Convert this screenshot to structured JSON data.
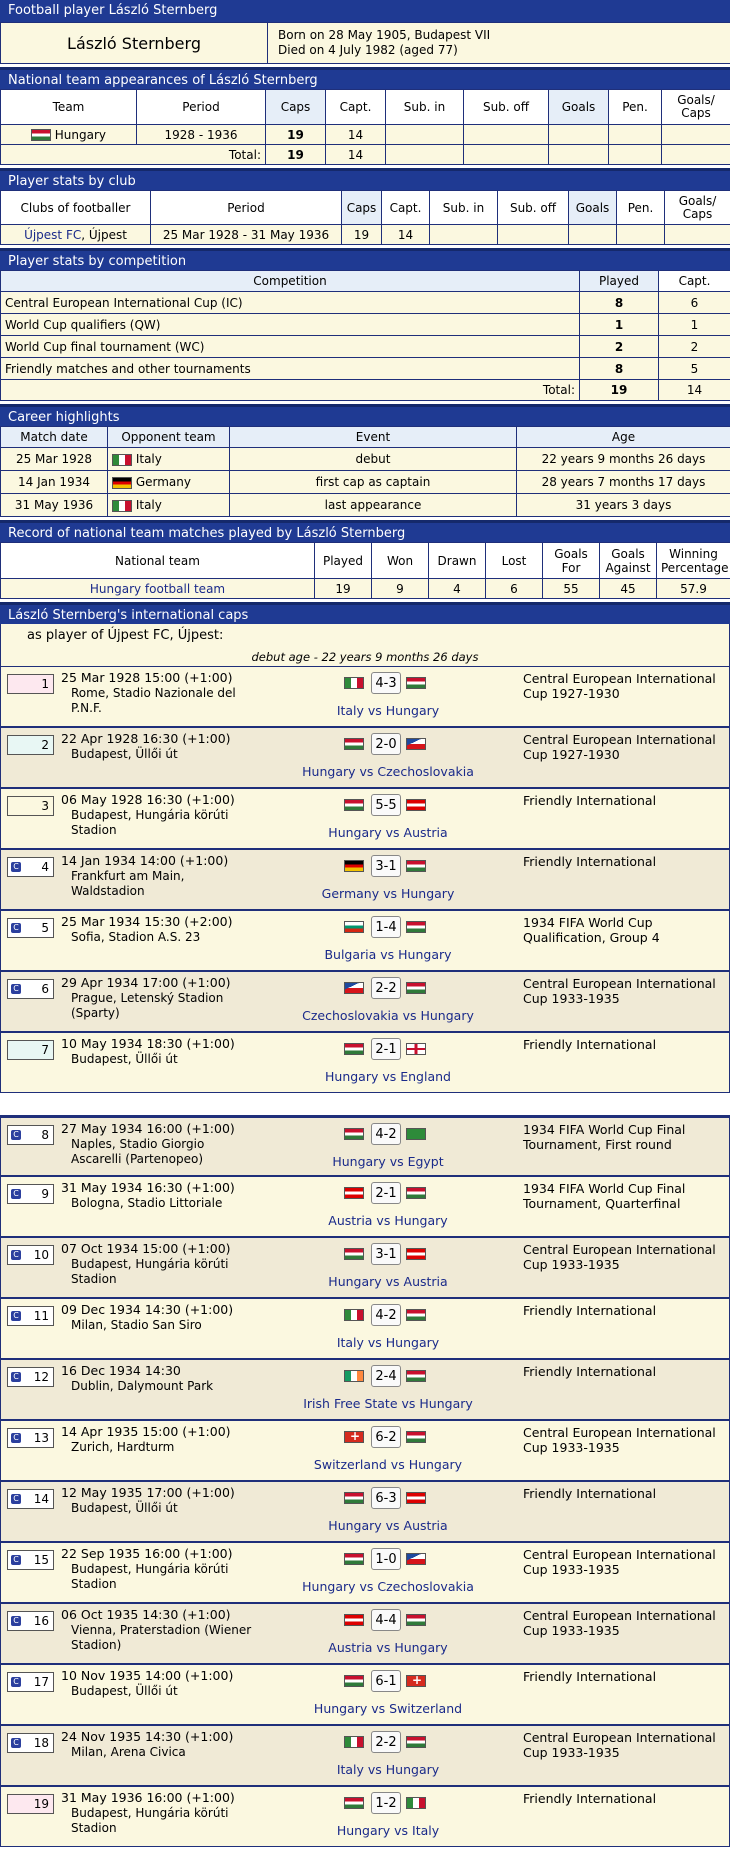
{
  "header": {
    "title": "Football player László Sternberg",
    "name": "László Sternberg",
    "born": "Born on 28 May 1905, Budapest VII",
    "died": "Died on 4 July 1982 (aged 77)"
  },
  "appearances": {
    "title": "National team appearances of László Sternberg",
    "cols": [
      "Team",
      "Period",
      "Caps",
      "Capt.",
      "Sub. in",
      "Sub. off",
      "Goals",
      "Pen.",
      "Goals/ Caps"
    ],
    "row": {
      "team": "Hungary",
      "period": "1928 - 1936",
      "caps": "19",
      "capt": "14"
    },
    "total": {
      "label": "Total:",
      "caps": "19",
      "capt": "14"
    }
  },
  "club": {
    "title": "Player stats by club",
    "cols": [
      "Clubs of footballer",
      "Period",
      "Caps",
      "Capt.",
      "Sub. in",
      "Sub. off",
      "Goals",
      "Pen.",
      "Goals/ Caps"
    ],
    "row": {
      "club": "Újpest FC",
      "city": ", Újpest",
      "period": "25 Mar 1928 - 31 May 1936",
      "caps": "19",
      "capt": "14"
    }
  },
  "competition": {
    "title": "Player stats by competition",
    "cols": [
      "Competition",
      "Played",
      "Capt."
    ],
    "rows": [
      {
        "name": "Central European International Cup (IC)",
        "played": "8",
        "capt": "6"
      },
      {
        "name": "World Cup qualifiers (QW)",
        "played": "1",
        "capt": "1"
      },
      {
        "name": "World Cup final tournament (WC)",
        "played": "2",
        "capt": "2"
      },
      {
        "name": "Friendly matches and other tournaments",
        "played": "8",
        "capt": "5"
      }
    ],
    "total": {
      "label": "Total:",
      "played": "19",
      "capt": "14"
    }
  },
  "highlights": {
    "title": "Career highlights",
    "cols": [
      "Match date",
      "Opponent team",
      "Event",
      "Age"
    ],
    "rows": [
      {
        "date": "25 Mar 1928",
        "flag": "fl-ita",
        "opp": "Italy",
        "event": "debut",
        "age": "22 years 9 months 26 days"
      },
      {
        "date": "14 Jan 1934",
        "flag": "fl-ger",
        "opp": "Germany",
        "event": "first cap as captain",
        "age": "28 years 7 months 17 days"
      },
      {
        "date": "31 May 1936",
        "flag": "fl-ita",
        "opp": "Italy",
        "event": "last appearance",
        "age": "31 years 3 days"
      }
    ]
  },
  "record": {
    "title": "Record of national team matches played by László Sternberg",
    "cols": [
      "National team",
      "Played",
      "Won",
      "Drawn",
      "Lost",
      "Goals For",
      "Goals Against",
      "Winning Percentage"
    ],
    "row": {
      "team": "Hungary football team",
      "played": "19",
      "won": "9",
      "drawn": "4",
      "lost": "6",
      "gf": "55",
      "ga": "45",
      "pct": "57.9"
    }
  },
  "caps": {
    "title": "László Sternberg's international caps",
    "as_player": "as player of Újpest FC, Újpest:",
    "debut_note": "debut age - 22 years 9 months 26 days",
    "matches": [
      {
        "n": "1",
        "date": "25 Mar 1928 15:00 (+1:00)",
        "venue": "Rome, Stadio Nazionale del P.N.F.",
        "f1": "fl-ita",
        "score": "4-3",
        "f2": "fl-hun",
        "teams": "Italy vs Hungary",
        "comp": "Central European International Cup 1927-1930"
      },
      {
        "n": "2",
        "date": "22 Apr 1928 16:30 (+1:00)",
        "venue": "Budapest, Üllői út",
        "f1": "fl-hun",
        "score": "2-0",
        "f2": "fl-cze",
        "teams": "Hungary vs Czechoslovakia",
        "comp": "Central European International Cup 1927-1930"
      },
      {
        "n": "3",
        "date": "06 May 1928 16:30 (+1:00)",
        "venue": "Budapest, Hungária körúti Stadion",
        "f1": "fl-hun",
        "score": "5-5",
        "f2": "fl-aut",
        "teams": "Hungary vs Austria",
        "comp": "Friendly International"
      },
      {
        "n": "4",
        "date": "14 Jan 1934 14:00 (+1:00)",
        "venue": "Frankfurt am Main, Waldstadion",
        "f1": "fl-ger",
        "score": "3-1",
        "f2": "fl-hun",
        "teams": "Germany vs Hungary",
        "comp": "Friendly International"
      },
      {
        "n": "5",
        "date": "25 Mar 1934 15:30 (+2:00)",
        "venue": "Sofia, Stadion A.S. 23",
        "f1": "fl-bul",
        "score": "1-4",
        "f2": "fl-hun",
        "teams": "Bulgaria vs Hungary",
        "comp": "1934 FIFA World Cup Qualification, Group 4"
      },
      {
        "n": "6",
        "date": "29 Apr 1934 17:00 (+1:00)",
        "venue": "Prague, Letenský Stadion (Sparty)",
        "f1": "fl-cze",
        "score": "2-2",
        "f2": "fl-hun",
        "teams": "Czechoslovakia vs Hungary",
        "comp": "Central European International Cup 1933-1935"
      },
      {
        "n": "7",
        "date": "10 May 1934 18:30 (+1:00)",
        "venue": "Budapest, Üllői út",
        "f1": "fl-hun",
        "score": "2-1",
        "f2": "fl-eng",
        "teams": "Hungary vs England",
        "comp": "Friendly International"
      },
      {
        "n": "8",
        "date": "27 May 1934 16:00 (+1:00)",
        "venue": "Naples, Stadio Giorgio Ascarelli (Partenopeo)",
        "f1": "fl-hun",
        "score": "4-2",
        "f2": "fl-egy",
        "teams": "Hungary vs Egypt",
        "comp": "1934 FIFA World Cup Final Tournament, First round"
      },
      {
        "n": "9",
        "date": "31 May 1934 16:30 (+1:00)",
        "venue": "Bologna, Stadio Littoriale",
        "f1": "fl-aut",
        "score": "2-1",
        "f2": "fl-hun",
        "teams": "Austria vs Hungary",
        "comp": "1934 FIFA World Cup Final Tournament, Quarterfinal"
      },
      {
        "n": "10",
        "date": "07 Oct 1934 15:00 (+1:00)",
        "venue": "Budapest, Hungária körúti Stadion",
        "f1": "fl-hun",
        "score": "3-1",
        "f2": "fl-aut",
        "teams": "Hungary vs Austria",
        "comp": "Central European International Cup 1933-1935"
      },
      {
        "n": "11",
        "date": "09 Dec 1934 14:30 (+1:00)",
        "venue": "Milan, Stadio San Siro",
        "f1": "fl-ita",
        "score": "4-2",
        "f2": "fl-hun",
        "teams": "Italy vs Hungary",
        "comp": "Friendly International"
      },
      {
        "n": "12",
        "date": "16 Dec 1934 14:30",
        "venue": "Dublin, Dalymount Park",
        "f1": "fl-irl",
        "score": "2-4",
        "f2": "fl-hun",
        "teams": "Irish Free State vs Hungary",
        "comp": "Friendly International"
      },
      {
        "n": "13",
        "date": "14 Apr 1935 15:00 (+1:00)",
        "venue": "Zurich, Hardturm",
        "f1": "fl-sui",
        "score": "6-2",
        "f2": "fl-hun",
        "teams": "Switzerland vs Hungary",
        "comp": "Central European International Cup 1933-1935"
      },
      {
        "n": "14",
        "date": "12 May 1935 17:00 (+1:00)",
        "venue": "Budapest, Üllői út",
        "f1": "fl-hun",
        "score": "6-3",
        "f2": "fl-aut",
        "teams": "Hungary vs Austria",
        "comp": "Friendly International"
      },
      {
        "n": "15",
        "date": "22 Sep 1935 16:00 (+1:00)",
        "venue": "Budapest, Hungária körúti Stadion",
        "f1": "fl-hun",
        "score": "1-0",
        "f2": "fl-cze",
        "teams": "Hungary vs Czechoslovakia",
        "comp": "Central European International Cup 1933-1935"
      },
      {
        "n": "16",
        "date": "06 Oct 1935 14:30 (+1:00)",
        "venue": "Vienna, Praterstadion (Wiener Stadion)",
        "f1": "fl-aut",
        "score": "4-4",
        "f2": "fl-hun",
        "teams": "Austria vs Hungary",
        "comp": "Central European International Cup 1933-1935"
      },
      {
        "n": "17",
        "date": "10 Nov 1935 14:00 (+1:00)",
        "venue": "Budapest, Üllői út",
        "f1": "fl-hun",
        "score": "6-1",
        "f2": "fl-sui",
        "teams": "Hungary vs Switzerland",
        "comp": "Friendly International"
      },
      {
        "n": "18",
        "date": "24 Nov 1935 14:30 (+1:00)",
        "venue": "Milan, Arena Civica",
        "f1": "fl-ita",
        "score": "2-2",
        "f2": "fl-hun",
        "teams": "Italy vs Hungary",
        "comp": "Central European International Cup 1933-1935"
      },
      {
        "n": "19",
        "date": "31 May 1936 16:00 (+1:00)",
        "venue": "Budapest, Hungária körúti Stadion",
        "f1": "fl-hun",
        "score": "1-2",
        "f2": "fl-ita",
        "teams": "Hungary vs Italy",
        "comp": "Friendly International"
      }
    ]
  }
}
